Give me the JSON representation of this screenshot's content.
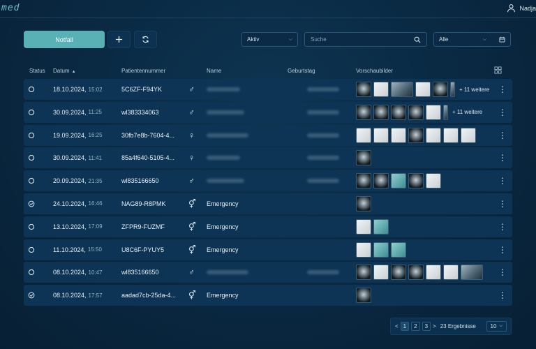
{
  "app": {
    "logo": "med",
    "user": "Nadja"
  },
  "toolbar": {
    "emergency_label": "Notfall",
    "status_filter": "Aktiv",
    "search_placeholder": "Suche",
    "date_filter": "Alle"
  },
  "table": {
    "columns": {
      "status": "Status",
      "date": "Datum",
      "patient_number": "Patientennummer",
      "name": "Name",
      "birthday": "Geburtstag",
      "previews": "Vorschaubilder"
    },
    "rows": [
      {
        "status": "circle",
        "date": "18.10.2024,",
        "time": "15:02",
        "patient_number": "5C6ZF-F94YK",
        "gender": "♂",
        "name": "",
        "previews": [
          "dark",
          "light",
          "wide",
          "light",
          "dark",
          "narrow"
        ],
        "more": "+ 11 weitere"
      },
      {
        "status": "circle",
        "date": "30.09.2024,",
        "time": "11:25",
        "patient_number": "wl383334063",
        "gender": "♂",
        "name": "",
        "previews": [
          "dark",
          "dark",
          "dark",
          "dark",
          "light",
          "narrow"
        ],
        "more": "+ 11 weitere"
      },
      {
        "status": "circle",
        "date": "19.09.2024,",
        "time": "16:25",
        "patient_number": "30fb7e8b-7604-4...",
        "gender": "♀",
        "name": "",
        "previews": [
          "light",
          "light",
          "light",
          "dark",
          "light",
          "light",
          "light"
        ],
        "more": ""
      },
      {
        "status": "circle",
        "date": "30.09.2024,",
        "time": "11:41",
        "patient_number": "85a4f640-5105-4...",
        "gender": "♀",
        "name": "",
        "previews": [
          "dark"
        ],
        "more": ""
      },
      {
        "status": "circle",
        "date": "20.09.2024,",
        "time": "21:35",
        "patient_number": "wl835166650",
        "gender": "♂",
        "name": "",
        "previews": [
          "dark",
          "dark",
          "teal",
          "dark",
          "light"
        ],
        "more": ""
      },
      {
        "status": "check",
        "date": "24.10.2024,",
        "time": "16:46",
        "patient_number": "NAG89-R8PMK",
        "gender": "⚥",
        "name": "Emergency",
        "previews": [
          "dark"
        ],
        "more": ""
      },
      {
        "status": "circle",
        "date": "13.10.2024,",
        "time": "17:09",
        "patient_number": "ZFPR9-FUZMF",
        "gender": "⚥",
        "name": "Emergency",
        "previews": [
          "light",
          "teal"
        ],
        "more": ""
      },
      {
        "status": "circle",
        "date": "11.10.2024,",
        "time": "15:50",
        "patient_number": "U8C6F-PYUY5",
        "gender": "⚥",
        "name": "Emergency",
        "previews": [
          "light",
          "teal",
          "teal"
        ],
        "more": ""
      },
      {
        "status": "circle",
        "date": "08.10.2024,",
        "time": "10:47",
        "patient_number": "wl835166650",
        "gender": "♂",
        "name": "",
        "previews": [
          "dark",
          "light",
          "dark",
          "dark",
          "light",
          "light",
          "wide"
        ],
        "more": ""
      },
      {
        "status": "check",
        "date": "08.10.2024,",
        "time": "17:57",
        "patient_number": "aadad7cb-25da-4...",
        "gender": "⚥",
        "name": "Emergency",
        "previews": [
          "dark"
        ],
        "more": ""
      }
    ]
  },
  "pagination": {
    "prev": "<",
    "pages": [
      "1",
      "2",
      "3"
    ],
    "current": "1",
    "next": ">",
    "results": "23 Ergebnisse",
    "per_page": "10"
  }
}
